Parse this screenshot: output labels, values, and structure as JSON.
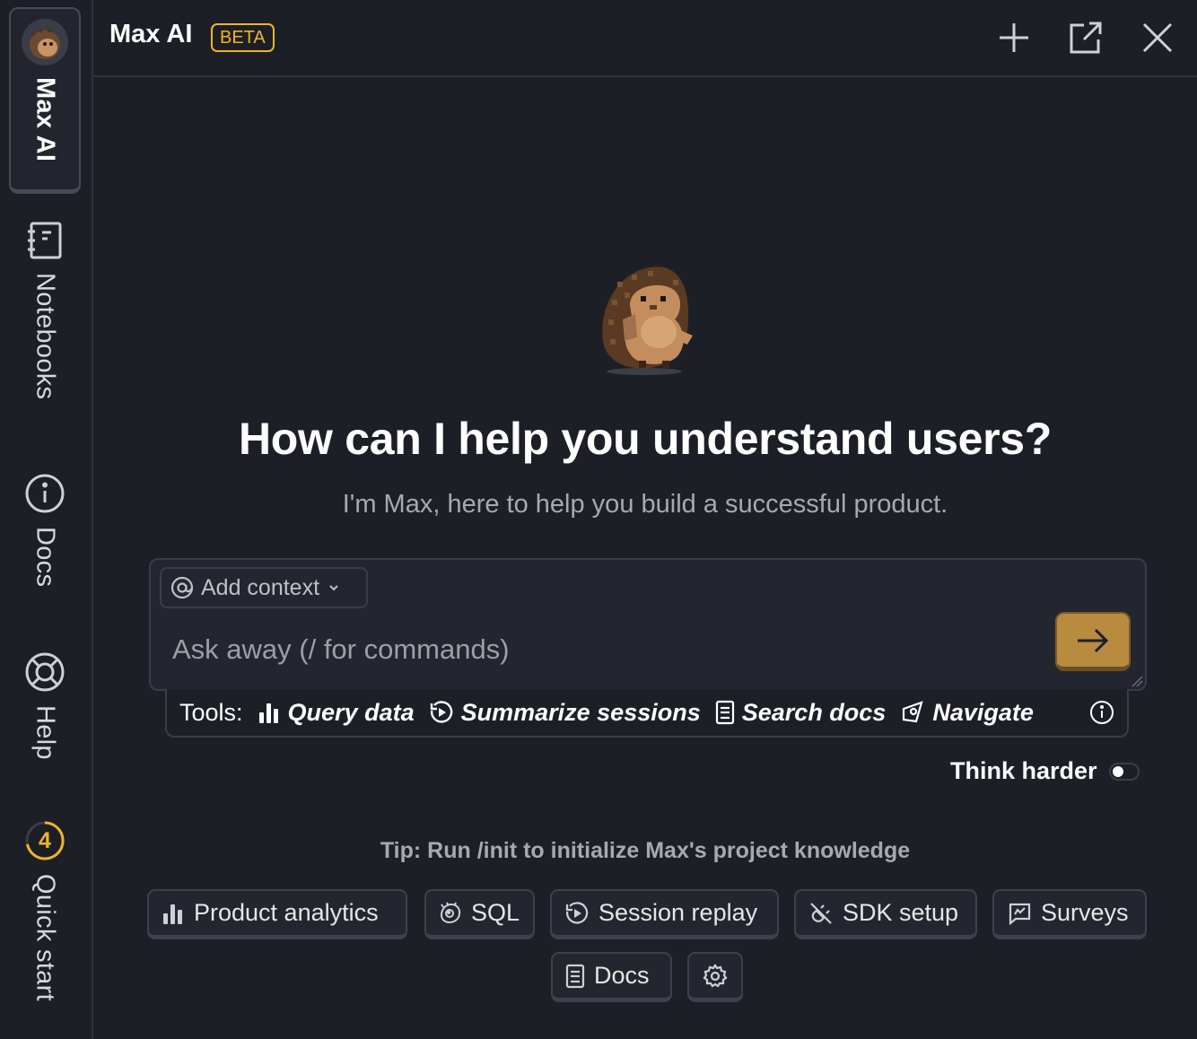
{
  "rail": {
    "tabs": [
      {
        "label": "Max AI",
        "icon": "hedgehog-avatar-icon",
        "active": true
      },
      {
        "label": "Notebooks",
        "icon": "notebook-icon"
      },
      {
        "label": "Docs",
        "icon": "info-icon"
      },
      {
        "label": "Help",
        "icon": "lifebuoy-icon"
      },
      {
        "label": "Quick start",
        "icon": "progress-ring-icon",
        "badge": "4"
      }
    ]
  },
  "header": {
    "title": "Max AI",
    "badge": "BETA",
    "actions": [
      "plus-icon",
      "open-external-icon",
      "close-icon"
    ]
  },
  "main": {
    "headline": "How can I help you understand users?",
    "subhead": "I'm Max, here to help you build a successful product.",
    "composer": {
      "context_button": "Add context",
      "placeholder": "Ask away (/ for commands)"
    },
    "tools": {
      "label": "Tools:",
      "items": [
        {
          "label": "Query data",
          "icon": "bar-chart-icon"
        },
        {
          "label": "Summarize sessions",
          "icon": "replay-icon"
        },
        {
          "label": "Search docs",
          "icon": "document-icon"
        },
        {
          "label": "Navigate",
          "icon": "compass-icon"
        }
      ]
    },
    "think_harder": "Think harder",
    "tip": "Tip: Run /init to initialize Max's project knowledge",
    "suggestions": [
      {
        "label": "Product analytics",
        "icon": "bar-chart-icon"
      },
      {
        "label": "SQL",
        "icon": "hedgehog-icon"
      },
      {
        "label": "Session replay",
        "icon": "replay-icon"
      },
      {
        "label": "SDK setup",
        "icon": "plug-icon"
      },
      {
        "label": "Surveys",
        "icon": "survey-icon"
      },
      {
        "label": "Docs",
        "icon": "document-icon"
      },
      {
        "label": "",
        "icon": "gear-icon"
      }
    ]
  },
  "colors": {
    "background": "#1d1f27",
    "accent": "#f0b429",
    "send_button": "#b88b3f"
  }
}
